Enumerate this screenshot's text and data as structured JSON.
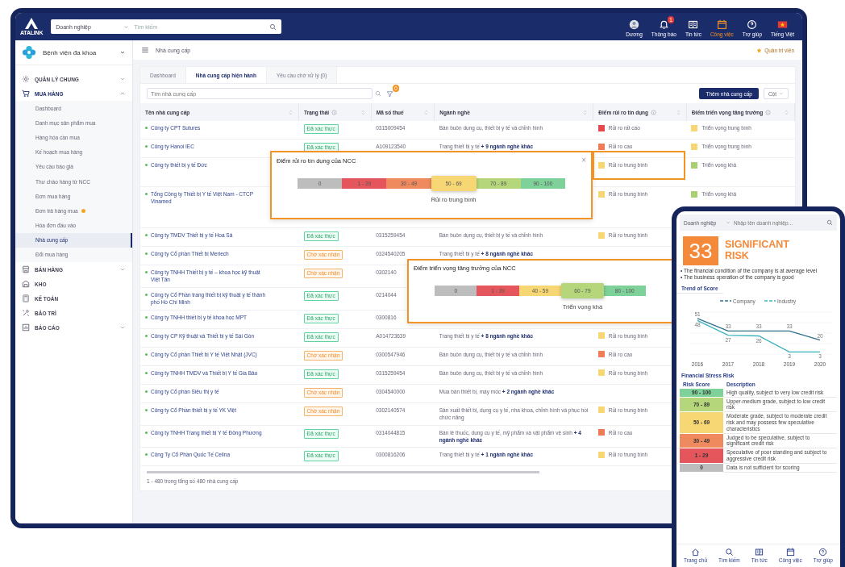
{
  "topbar": {
    "logo_text": "ATALINK",
    "search": {
      "category": "Doanh nghiệp",
      "placeholder": "Tìm kiếm"
    },
    "nav": [
      {
        "kind": "avatar",
        "label": "Dương",
        "selected": false
      },
      {
        "kind": "bell",
        "label": "Thông báo",
        "selected": false,
        "badge": "1"
      },
      {
        "kind": "news",
        "label": "Tin tức",
        "selected": false
      },
      {
        "kind": "calendar",
        "label": "Công việc",
        "selected": true
      },
      {
        "kind": "help",
        "label": "Trợ giúp",
        "selected": false
      },
      {
        "kind": "flag",
        "label": "Tiếng Việt",
        "selected": false
      }
    ]
  },
  "sidebar": {
    "organization": "Bệnh viện đa khoa",
    "groups": [
      {
        "kind": "gear",
        "label": "QUẢN LÝ CHUNG",
        "expanded": false
      },
      {
        "kind": "cart",
        "label": "MUA HÀNG",
        "expanded": true,
        "children": [
          {
            "label": "Dashboard",
            "selected": false,
            "flagged": false
          },
          {
            "label": "Danh mục sản phẩm mua",
            "selected": false,
            "flagged": false
          },
          {
            "label": "Hàng hóa cần mua",
            "selected": false,
            "flagged": false
          },
          {
            "label": "Kế hoạch mua hàng",
            "selected": false,
            "flagged": false
          },
          {
            "label": "Yêu cầu báo giá",
            "selected": false,
            "flagged": false
          },
          {
            "label": "Thư chào hàng từ NCC",
            "selected": false,
            "flagged": false
          },
          {
            "label": "Đơn mua hàng",
            "selected": false,
            "flagged": false
          },
          {
            "label": "Đơn trả hàng mua",
            "selected": false,
            "flagged": true
          },
          {
            "label": "Hóa đơn đầu vào",
            "selected": false,
            "flagged": false
          },
          {
            "label": "Nhà cung cấp",
            "selected": true,
            "flagged": false
          },
          {
            "label": "Đổi mua hàng",
            "selected": false,
            "flagged": false
          }
        ]
      },
      {
        "kind": "store",
        "label": "BÁN HÀNG",
        "expanded": false
      },
      {
        "kind": "warehouse",
        "label": "KHO"
      },
      {
        "kind": "calculator",
        "label": "KẾ TOÁN"
      },
      {
        "kind": "tools",
        "label": "BẢO TRÌ"
      },
      {
        "kind": "report",
        "label": "BÁO CÁO",
        "expanded": false
      }
    ]
  },
  "header": {
    "breadcrumb": "Nhà cung cấp",
    "user_role": "Quản trị viên"
  },
  "tabs": [
    {
      "label": "Dashboard",
      "selected": false
    },
    {
      "label": "Nhà cung cấp hiện hành",
      "selected": true
    },
    {
      "label": "Yêu cầu chờ xử lý (0)",
      "selected": false
    }
  ],
  "toolbar": {
    "search_placeholder": "Tìm nhà cung cấp",
    "filter_badge": "0",
    "add_button": "Thêm nhà cung cấp",
    "columns_button": "Cột"
  },
  "table": {
    "columns": [
      {
        "label": "Tên nhà cung cấp",
        "info": false
      },
      {
        "label": "Trạng thái",
        "info": true
      },
      {
        "label": "Mã số thuế",
        "info": false
      },
      {
        "label": "Ngành nghề",
        "info": false
      },
      {
        "label": "Điểm rủi ro tín dụng",
        "info": true
      },
      {
        "label": "Điểm triển vọng tăng trưởng",
        "info": true
      }
    ],
    "rows": [
      {
        "name": "Công ty CPT Sutures",
        "status": {
          "label": "Đã xác thực",
          "verified": true
        },
        "tax_code": "0315009454",
        "industry": "Bán buôn dụng cụ, thiết bị y tế và chỉnh hình",
        "risk": {
          "label": "Rủi ro rất cao",
          "color": "#e5484d"
        },
        "growth": {
          "label": "Triển vọng trung bình",
          "color": "#f7d774"
        }
      },
      {
        "name": "Công ty Hanoi IEC",
        "status": {
          "label": "Đã xác thực",
          "verified": true
        },
        "tax_code": "A109123540",
        "industry": "Trang thiết bị y tế **+ 9 ngành nghề khác**",
        "risk": {
          "label": "Rủi ro cao",
          "color": "#ef7b57"
        },
        "growth": {
          "label": "Triển vọng trung bình",
          "color": "#f7d774"
        }
      },
      {
        "name": "Công ty thiết bị y tế Đức",
        "risk": {
          "label": "Rủi ro trung bình",
          "color": "#f7d774"
        },
        "growth": {
          "label": "Triển vọng khá",
          "color": "#a9cf6e"
        }
      },
      {
        "name": "Tổng Công ty Thiết bị Y tế Việt Nam - CTCP Vinamed",
        "risk": {
          "label": "Rủi ro trung bình",
          "color": "#f7d774"
        },
        "growth": {
          "label": "Triển vọng khá",
          "color": "#a9cf6e"
        }
      },
      {
        "name": "Công ty TMDV Thiết bị y tế Hoa Sả",
        "status": {
          "label": "Đã xác thực",
          "verified": true
        },
        "tax_code": "0315259454",
        "industry": "Bán buôn dụng cụ, thiết bị y tế và chỉnh hình",
        "risk": {
          "label": "Rủi ro trung bình",
          "color": "#f7d774"
        }
      },
      {
        "name": "Công ty Cổ phần Thiết bị Meriech",
        "status": {
          "label": "Chờ xác nhận",
          "verified": false
        },
        "tax_code": "0324540205",
        "industry": "Trang thiết bị y tế **+ 8 ngành nghề khác**"
      },
      {
        "name": "Công ty TNHH Thiết bị y tế – khoa học kỹ thuật Việt Tân",
        "status": {
          "label": "Chờ xác nhận",
          "verified": false
        },
        "tax_code": "0302140"
      },
      {
        "name": "Công ty Cổ Phần trang thiết bị kỹ thuật y tế thành phố Hồ Chí Minh",
        "status": {
          "label": "Đã xác thực",
          "verified": true
        },
        "tax_code": "0214044"
      },
      {
        "name": "Công ty TNHH thiết bị y tế khoa học MPT",
        "status": {
          "label": "Đã xác thực",
          "verified": true
        },
        "tax_code": "0300816"
      },
      {
        "name": "Công ty CP Kỹ thuật và Thiết bị y tế Sài Gòn",
        "status": {
          "label": "Đã xác thực",
          "verified": true
        },
        "tax_code": "A014723639",
        "industry": "Trang thiết bị y tế **+ 8 ngành nghề khác**",
        "risk": {
          "label": "Rủi ro trung bình",
          "color": "#f7d774"
        }
      },
      {
        "name": "Công ty Cổ phần Thiết bị Y tế Việt Nhật (JVC)",
        "status": {
          "label": "Chờ xác nhận",
          "verified": false
        },
        "tax_code": "0300547946",
        "industry": "Bán buôn dụng cụ, thiết bị y tế và chỉnh hình",
        "risk": {
          "label": "Rủi ro cao",
          "color": "#ef7b57"
        }
      },
      {
        "name": "Công ty TNHH TMDV và Thiết bị Y tế Gia Bảo",
        "status": {
          "label": "Đã xác thực",
          "verified": true
        },
        "tax_code": "0315259454",
        "industry": "Bán buôn dụng cụ, thiết bị y tế và chỉnh hình",
        "risk": {
          "label": "Rủi ro trung bình",
          "color": "#f7d774"
        }
      },
      {
        "name": "Công ty Cổ phần Siêu thị y tế",
        "status": {
          "label": "Chờ xác nhận",
          "verified": false
        },
        "tax_code": "0304540000",
        "industry": "Mua bán thiết bị, máy móc **+ 2 ngành nghề khác**"
      },
      {
        "name": "Công ty Cổ Phần thiết bị y tế YK Việt",
        "status": {
          "label": "Chờ xác nhận",
          "verified": false
        },
        "tax_code": "0302140574",
        "industry": "Sản xuất thiết bị, dụng cụ y tế, nha khoa, chỉnh hình và phục hồi chức năng",
        "risk": {
          "label": "Rủi ro trung bình",
          "color": "#f7d774"
        }
      },
      {
        "name": "Công ty TNHH Trang thiết bị Y tế Đông Phương",
        "status": {
          "label": "Đã xác thực",
          "verified": true
        },
        "tax_code": "0314044815",
        "industry": "Bán lẻ thuốc, dụng cụ y tế, mỹ phẩm và vật phẩm vệ sinh **+ 4 ngành nghề khác**",
        "risk": {
          "label": "Rủi ro cao",
          "color": "#ef7b57"
        }
      },
      {
        "name": "Công Ty Cổ Phần Quốc Tế Celina",
        "status": {
          "label": "Đã xác thực",
          "verified": true
        },
        "tax_code": "0300816206",
        "industry": "Trang thiết bị y tế **+ 1 ngành nghề khác**",
        "risk": {
          "label": "Rủi ro trung bình",
          "color": "#f7d774"
        }
      }
    ],
    "footer": "1 - 480 trong tổng số 480 nhà cung cấp"
  },
  "popups": [
    {
      "title": "Điểm rủi ro tín dụng của NCC",
      "close": "×",
      "caption": "Rủi ro trung bình",
      "segments": [
        {
          "label": "0",
          "color": "#bdbdbd",
          "selected": false
        },
        {
          "label": "1 - 29",
          "color": "#e5565c",
          "selected": false
        },
        {
          "label": "30 - 49",
          "color": "#ef8a5e",
          "selected": false
        },
        {
          "label": "50 - 69",
          "color": "#f7d774",
          "selected": true
        },
        {
          "label": "70 - 89",
          "color": "#b5d67a",
          "selected": false
        },
        {
          "label": "90 - 100",
          "color": "#7fd19a",
          "selected": false
        }
      ]
    },
    {
      "title": "Điểm triển vọng tăng trưởng của NCC",
      "caption": "Triển vọng khá",
      "segments": [
        {
          "label": "0",
          "color": "#bdbdbd",
          "selected": false
        },
        {
          "label": "1 - 39",
          "color": "#e5565c",
          "selected": false
        },
        {
          "label": "40 - 59",
          "color": "#f7d774",
          "selected": false
        },
        {
          "label": "60 - 79",
          "color": "#b5d67a",
          "selected": true
        },
        {
          "label": "80 - 100",
          "color": "#7fd19a",
          "selected": false
        }
      ]
    }
  ],
  "phone": {
    "search": {
      "category": "Doanh nghiệp",
      "placeholder": "Nhập tên doanh nghiệp..."
    },
    "score": "33",
    "verdict": "SIGNIFICANT RISK",
    "notes": [
      "• The financial condition of the company is at average level",
      "• The business operation of the company is good"
    ],
    "trend_title": "Trend of Score",
    "chart_data": {
      "type": "line",
      "legend": "top",
      "categories": [
        "2016",
        "2017",
        "2018",
        "2019",
        "2020"
      ],
      "series": [
        {
          "name": "Company",
          "color": "#2f6f8a",
          "values": [
            51,
            33,
            33,
            33,
            20
          ]
        },
        {
          "name": "Industry",
          "color": "#3bb3bd",
          "values": [
            48,
            27,
            26,
            3,
            3
          ]
        }
      ],
      "data_labels": true
    },
    "stress_title": "Financial Stress Risk",
    "stress_columns": [
      "Risk Score",
      "Description"
    ],
    "stress_rows": [
      {
        "score": "90 - 100",
        "color": "#7fd19a",
        "description": "High quality, subject to very low credit risk"
      },
      {
        "score": "70 - 89",
        "color": "#b5d67a",
        "description": "Upper-medium grade, subject to low credit risk"
      },
      {
        "score": "50 - 69",
        "color": "#f7d774",
        "description": "Moderate grade, subject to moderate credit risk and may possess few speculative characteristics"
      },
      {
        "score": "30 - 49",
        "color": "#ef8a5e",
        "description": "Judged to be speculative, subject to significant credit risk"
      },
      {
        "score": "1 - 29",
        "color": "#e5565c",
        "description": "Speculative of poor standing and subject to aggressive credit risk"
      },
      {
        "score": "0",
        "color": "#bdbdbd",
        "description": "Data is not sufficient for scoring"
      }
    ],
    "nav": [
      {
        "kind": "home",
        "label": "Trang chủ"
      },
      {
        "kind": "search",
        "label": "Tìm kiếm"
      },
      {
        "kind": "news",
        "label": "Tin tức"
      },
      {
        "kind": "calendar",
        "label": "Công việc"
      },
      {
        "kind": "help",
        "label": "Trợ giúp"
      }
    ]
  }
}
